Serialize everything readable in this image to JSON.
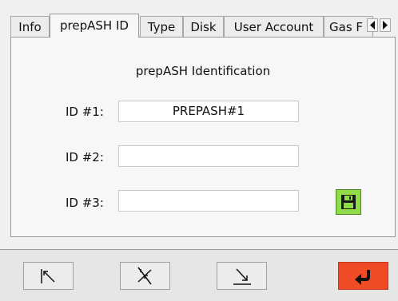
{
  "tabs": [
    {
      "label": "Info",
      "active": false
    },
    {
      "label": "prepASH ID",
      "active": true
    },
    {
      "label": "Type",
      "active": false
    },
    {
      "label": "Disk",
      "active": false
    },
    {
      "label": "User Account",
      "active": false
    },
    {
      "label": "Gas F",
      "active": false
    }
  ],
  "panel": {
    "title": "prepASH Identification",
    "fields": [
      {
        "label": "ID #1:",
        "value": "PREPASH#1"
      },
      {
        "label": "ID #2:",
        "value": ""
      },
      {
        "label": "ID #3:",
        "value": ""
      }
    ]
  },
  "icons": {
    "tab_scroll_left": "triangle-left-icon",
    "tab_scroll_right": "triangle-right-icon",
    "save": "floppy-disk-icon",
    "toolbar_first": "arrow-up-left-icon",
    "toolbar_middle": "arrows-converge-icon",
    "toolbar_last": "arrow-down-right-icon",
    "confirm": "return-arrow-icon"
  },
  "colors": {
    "save_button": "#8fdb4a",
    "confirm_button": "#f04b27"
  }
}
